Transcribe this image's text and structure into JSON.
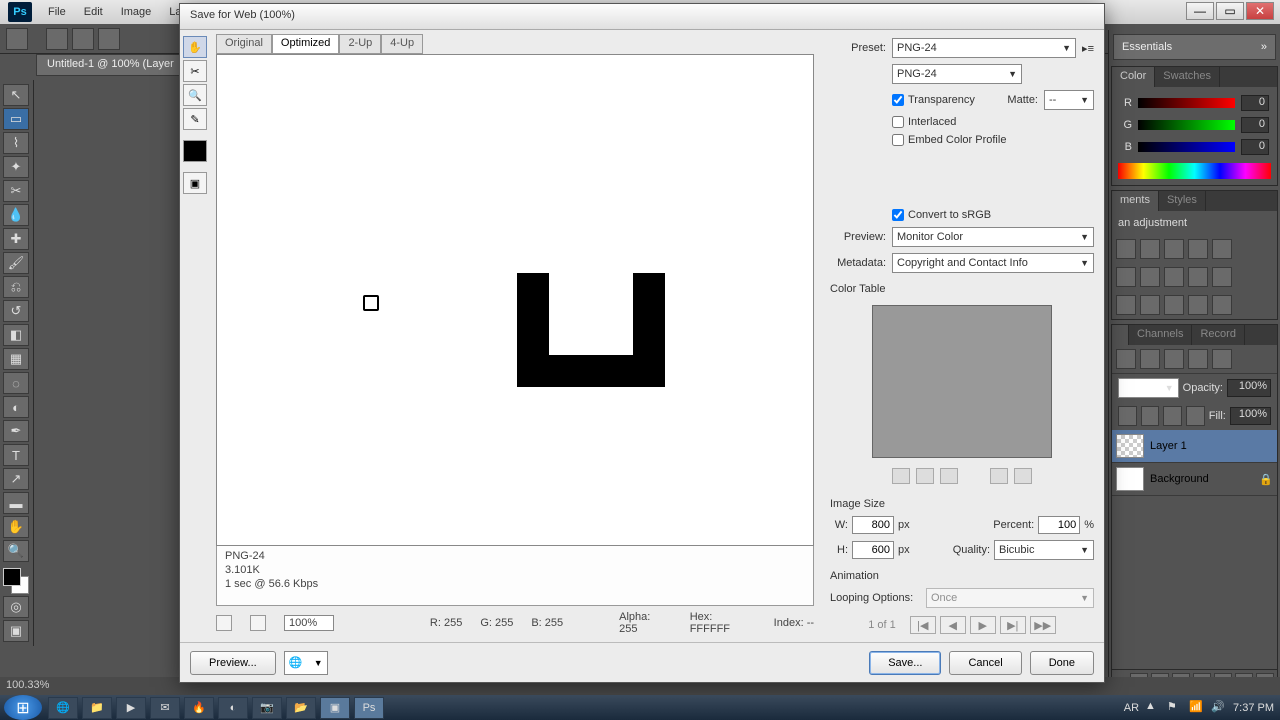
{
  "app": {
    "menus": [
      "File",
      "Edit",
      "Image",
      "Lay"
    ],
    "doc_tab": "Untitled-1 @ 100% (Layer"
  },
  "workspace": "Essentials",
  "color_panel": {
    "tabs": [
      "Color",
      "Swatches"
    ],
    "channels": [
      {
        "name": "R",
        "value": "0"
      },
      {
        "name": "G",
        "value": "0"
      },
      {
        "name": "B",
        "value": "0"
      }
    ]
  },
  "adjustments": {
    "tabs": [
      "ments",
      "Styles"
    ],
    "title": "an adjustment"
  },
  "layers_panel": {
    "tabs": [
      "",
      "Channels",
      "Record"
    ],
    "opacity_label": "Opacity:",
    "opacity": "100%",
    "fill_label": "Fill:",
    "fill": "100%",
    "layers": [
      {
        "name": "Layer 1",
        "selected": true,
        "trans": true
      },
      {
        "name": "Background",
        "selected": false,
        "trans": false
      }
    ]
  },
  "statusbar": {
    "zoom": "100.33%"
  },
  "dialog": {
    "title": "Save for Web (100%)",
    "view_tabs": [
      "Original",
      "Optimized",
      "2-Up",
      "4-Up"
    ],
    "active_view": 1,
    "stats": {
      "format": "PNG-24",
      "size": "3.101K",
      "time": "1 sec @ 56.6 Kbps"
    },
    "zoom": "100%",
    "readout": {
      "r": "R: 255",
      "g": "G: 255",
      "b": "B: 255",
      "alpha": "Alpha: 255",
      "hex": "Hex: FFFFFF",
      "index": "Index: --"
    },
    "right": {
      "preset_label": "Preset:",
      "preset": "PNG-24",
      "format": "PNG-24",
      "transparency": "Transparency",
      "transparency_checked": true,
      "matte_label": "Matte:",
      "matte": "--",
      "interlaced": "Interlaced",
      "embed_profile": "Embed Color Profile",
      "convert_srgb": "Convert to sRGB",
      "convert_srgb_checked": true,
      "preview_label": "Preview:",
      "preview": "Monitor Color",
      "metadata_label": "Metadata:",
      "metadata": "Copyright and Contact Info",
      "color_table": "Color Table",
      "image_size": "Image Size",
      "w_label": "W:",
      "w": "800",
      "h_label": "H:",
      "h": "600",
      "px": "px",
      "percent_label": "Percent:",
      "percent": "100",
      "pct": "%",
      "quality_label": "Quality:",
      "quality": "Bicubic",
      "animation": "Animation",
      "looping_label": "Looping Options:",
      "looping": "Once",
      "frame": "1 of 1"
    },
    "footer": {
      "preview": "Preview...",
      "save": "Save...",
      "cancel": "Cancel",
      "done": "Done"
    }
  },
  "taskbar": {
    "time": "7:37 PM",
    "lang": "AR"
  }
}
